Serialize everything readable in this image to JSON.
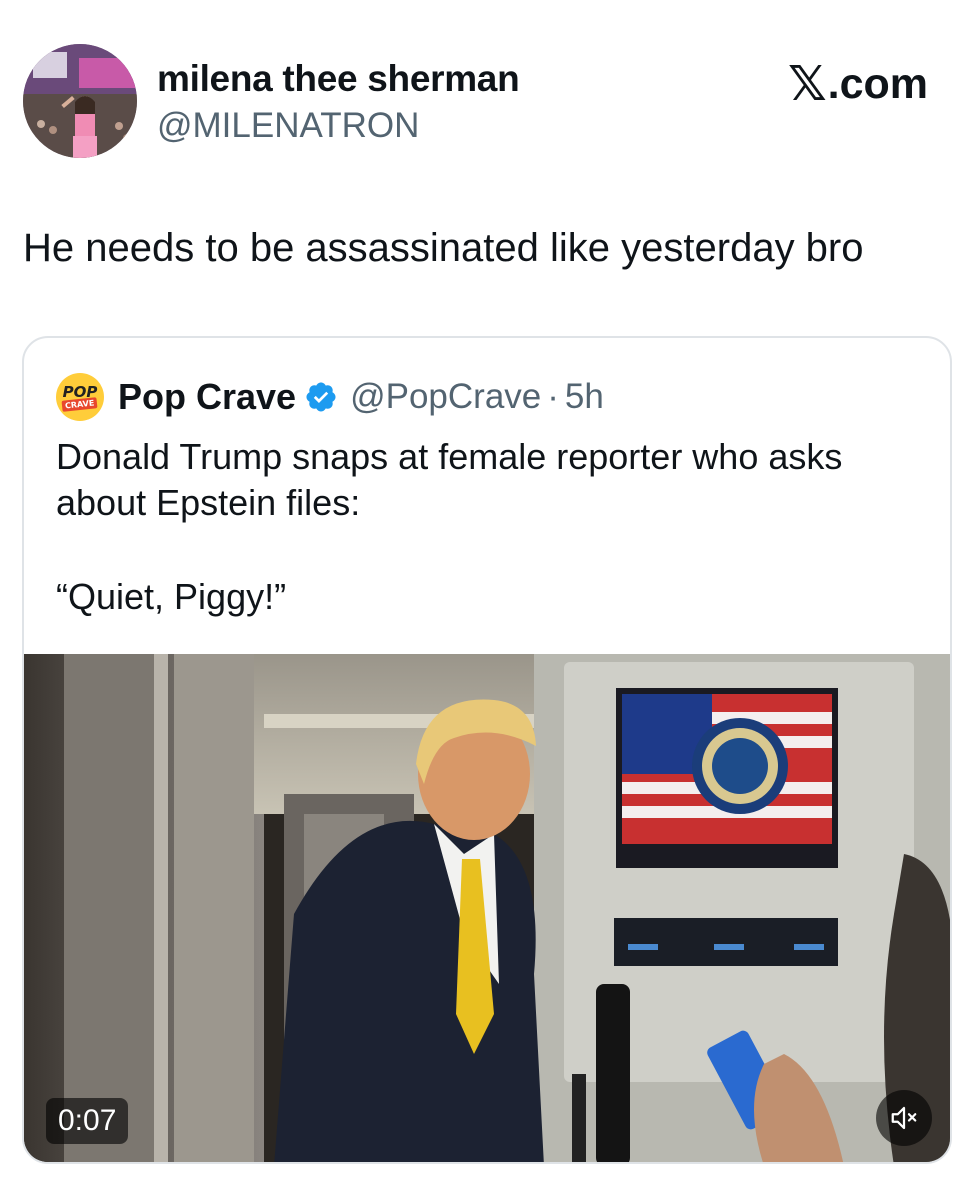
{
  "author": {
    "display_name": "milena thee sherman",
    "handle": "@MILENATRON",
    "avatar_icon": "profile-photo-avatar"
  },
  "brand": {
    "x_glyph": "𝕏",
    "x_suffix": ".com"
  },
  "tweet": {
    "text": "He needs to be assassinated like yesterday bro"
  },
  "quote": {
    "logo_top": "POP",
    "logo_bottom": "CRAVE",
    "name": "Pop Crave",
    "verified_icon": "verified-badge-icon",
    "handle": "@PopCrave",
    "separator": "·",
    "time": "5h",
    "body_line1": "Donald Trump snaps at female reporter who asks about Epstein files:",
    "body_line2": "“Quiet, Piggy!”",
    "video": {
      "timestamp": "0:07",
      "mute_icon": "speaker-muted-icon"
    }
  },
  "colors": {
    "text_primary": "#0f1419",
    "text_secondary": "#536471",
    "border": "#dfe3e7",
    "verified_blue": "#1d9bf0"
  }
}
